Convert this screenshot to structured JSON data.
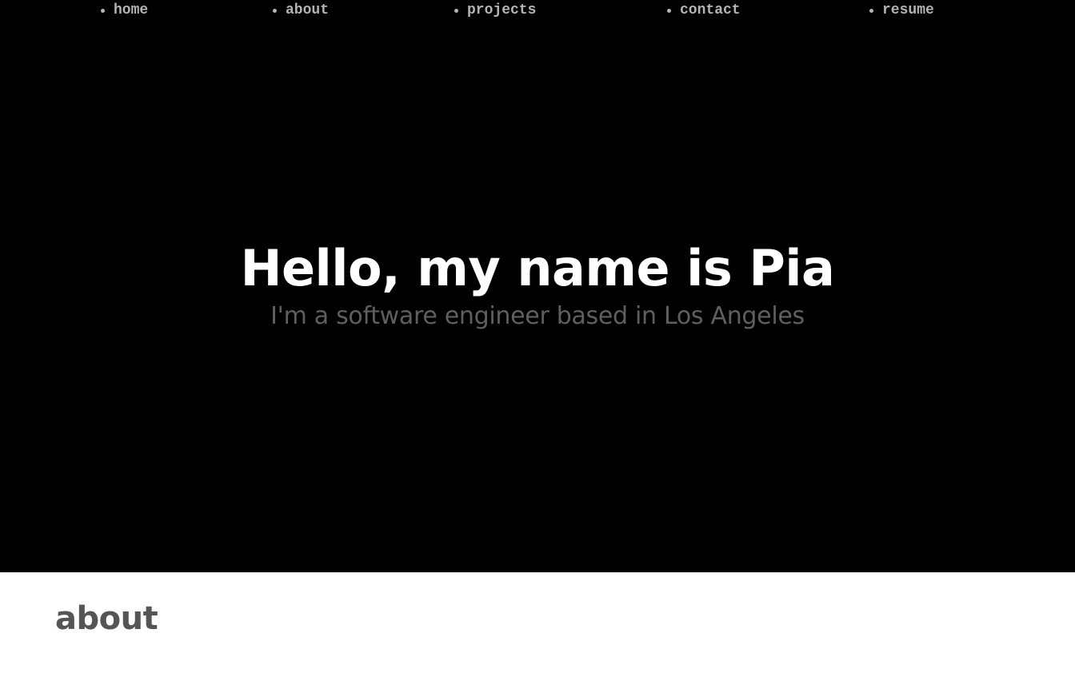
{
  "nav": {
    "items": [
      {
        "label": "home"
      },
      {
        "label": "about"
      },
      {
        "label": "projects"
      },
      {
        "label": "contact"
      },
      {
        "label": "resume"
      }
    ]
  },
  "hero": {
    "title": "Hello, my name is Pia",
    "subtitle": "I'm a software engineer based in Los Angeles"
  },
  "about": {
    "heading": "about"
  },
  "colors": {
    "hero_background": "#000000",
    "nav_text": "#b4b4b4",
    "title_text": "#ffffff",
    "subtitle_text": "#5f5f5f",
    "about_heading_text": "#555555",
    "page_background": "#ffffff"
  }
}
